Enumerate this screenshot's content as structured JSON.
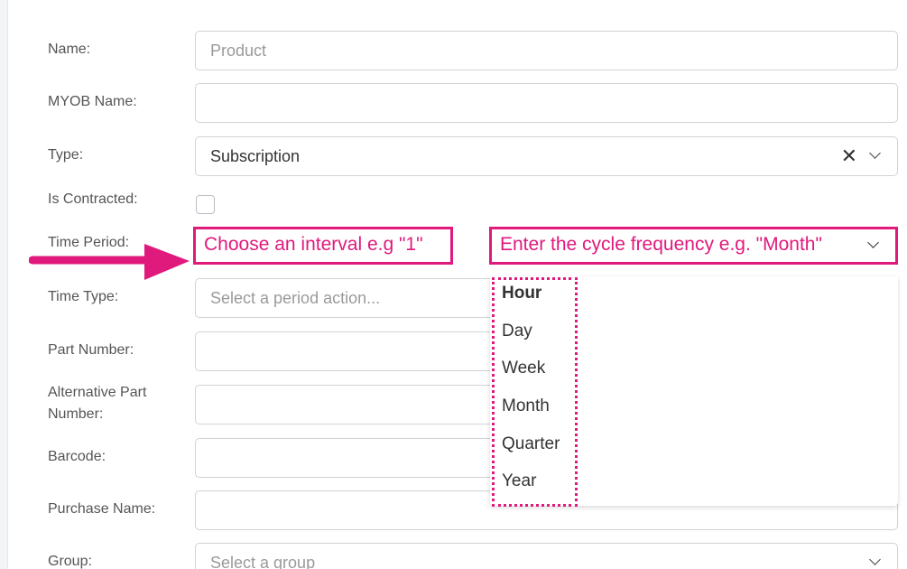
{
  "form": {
    "name_label": "Name:",
    "name_value": "Product",
    "myob_label": "MYOB Name:",
    "myob_value": "",
    "type_label": "Type:",
    "type_value": "Subscription",
    "type_clear": "✕",
    "contracted_label": "Is Contracted:",
    "contracted_checked": false,
    "time_period_label": "Time Period:",
    "time_type_label": "Time Type:",
    "time_type_placeholder": "Select a period action...",
    "part_number_label": "Part Number:",
    "alt_part_label": "Alternative Part Number:",
    "barcode_label": "Barcode:",
    "purchase_name_label": "Purchase Name:",
    "group_label": "Group:",
    "group_placeholder": "Select a group"
  },
  "annotations": {
    "interval_hint": "Choose an interval e.g \"1\"",
    "frequency_hint": "Enter the cycle frequency e.g. \"Month\"",
    "accent_color": "#e0197d"
  },
  "dropdown": {
    "options": [
      "Hour",
      "Day",
      "Week",
      "Month",
      "Quarter",
      "Year"
    ],
    "highlighted": "Hour"
  }
}
